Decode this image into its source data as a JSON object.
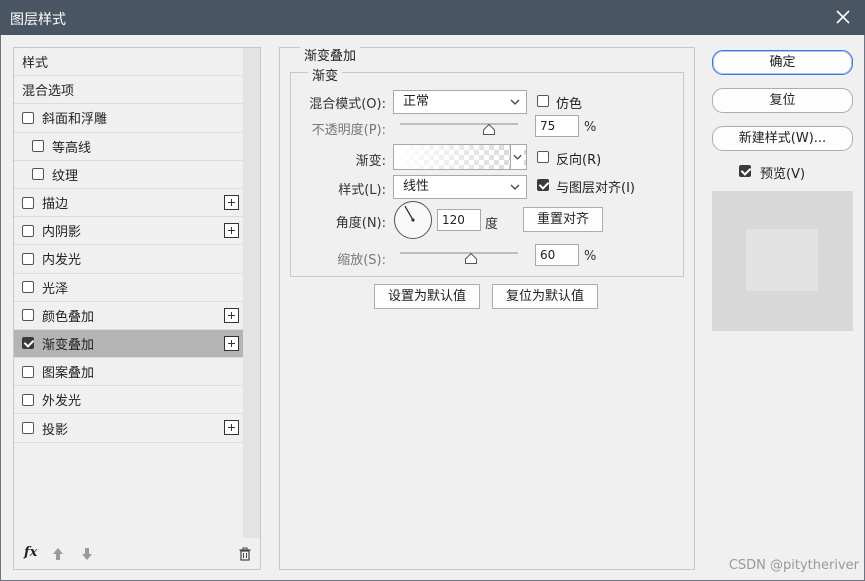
{
  "window": {
    "title": "图层样式",
    "close_icon": "close-icon"
  },
  "styles_list": {
    "items": [
      {
        "label": "样式",
        "checkbox": false,
        "checked": false,
        "plus": false,
        "indent": false,
        "selected": false
      },
      {
        "label": "混合选项",
        "checkbox": false,
        "checked": false,
        "plus": false,
        "indent": false,
        "selected": false
      },
      {
        "label": "斜面和浮雕",
        "checkbox": true,
        "checked": false,
        "plus": false,
        "indent": false,
        "selected": false
      },
      {
        "label": "等高线",
        "checkbox": true,
        "checked": false,
        "plus": false,
        "indent": true,
        "selected": false
      },
      {
        "label": "纹理",
        "checkbox": true,
        "checked": false,
        "plus": false,
        "indent": true,
        "selected": false
      },
      {
        "label": "描边",
        "checkbox": true,
        "checked": false,
        "plus": true,
        "indent": false,
        "selected": false
      },
      {
        "label": "内阴影",
        "checkbox": true,
        "checked": false,
        "plus": true,
        "indent": false,
        "selected": false
      },
      {
        "label": "内发光",
        "checkbox": true,
        "checked": false,
        "plus": false,
        "indent": false,
        "selected": false
      },
      {
        "label": "光泽",
        "checkbox": true,
        "checked": false,
        "plus": false,
        "indent": false,
        "selected": false
      },
      {
        "label": "颜色叠加",
        "checkbox": true,
        "checked": false,
        "plus": true,
        "indent": false,
        "selected": false
      },
      {
        "label": "渐变叠加",
        "checkbox": true,
        "checked": true,
        "plus": true,
        "indent": false,
        "selected": true
      },
      {
        "label": "图案叠加",
        "checkbox": true,
        "checked": false,
        "plus": false,
        "indent": false,
        "selected": false
      },
      {
        "label": "外发光",
        "checkbox": true,
        "checked": false,
        "plus": false,
        "indent": false,
        "selected": false
      },
      {
        "label": "投影",
        "checkbox": true,
        "checked": false,
        "plus": true,
        "indent": false,
        "selected": false
      }
    ],
    "footer": {
      "fx_label": "fx",
      "icons": [
        "fx-icon",
        "move-up-icon",
        "move-down-icon",
        "trash-icon"
      ]
    }
  },
  "gradient_overlay": {
    "section_title": "渐变叠加",
    "group_title": "渐变",
    "blend_mode_label": "混合模式(O):",
    "blend_mode_value": "正常",
    "dither_label": "仿色",
    "dither_checked": false,
    "opacity_label": "不透明度(P):",
    "opacity_value": "75",
    "opacity_level": 75,
    "gradient_label": "渐变:",
    "reverse_label": "反向(R)",
    "reverse_checked": false,
    "style_label": "样式(L):",
    "style_value": "线性",
    "align_label": "与图层对齐(I)",
    "align_checked": true,
    "angle_label": "角度(N):",
    "angle_value": "120",
    "angle_unit": "度",
    "reset_align_button": "重置对齐",
    "scale_label": "缩放(S):",
    "scale_value": "60",
    "scale_level": 60,
    "percent_unit": "%",
    "make_default_button": "设置为默认值",
    "reset_default_button": "复位为默认值"
  },
  "actions": {
    "ok": "确定",
    "reset": "复位",
    "new_style": "新建样式(W)...",
    "preview_label": "预览(V)",
    "preview_checked": true
  },
  "watermark": "CSDN @pitytheriver",
  "colors": {
    "titlebar": "#4a5563",
    "accent": "#3d78d8",
    "selected_row": "#b4b4b4"
  }
}
